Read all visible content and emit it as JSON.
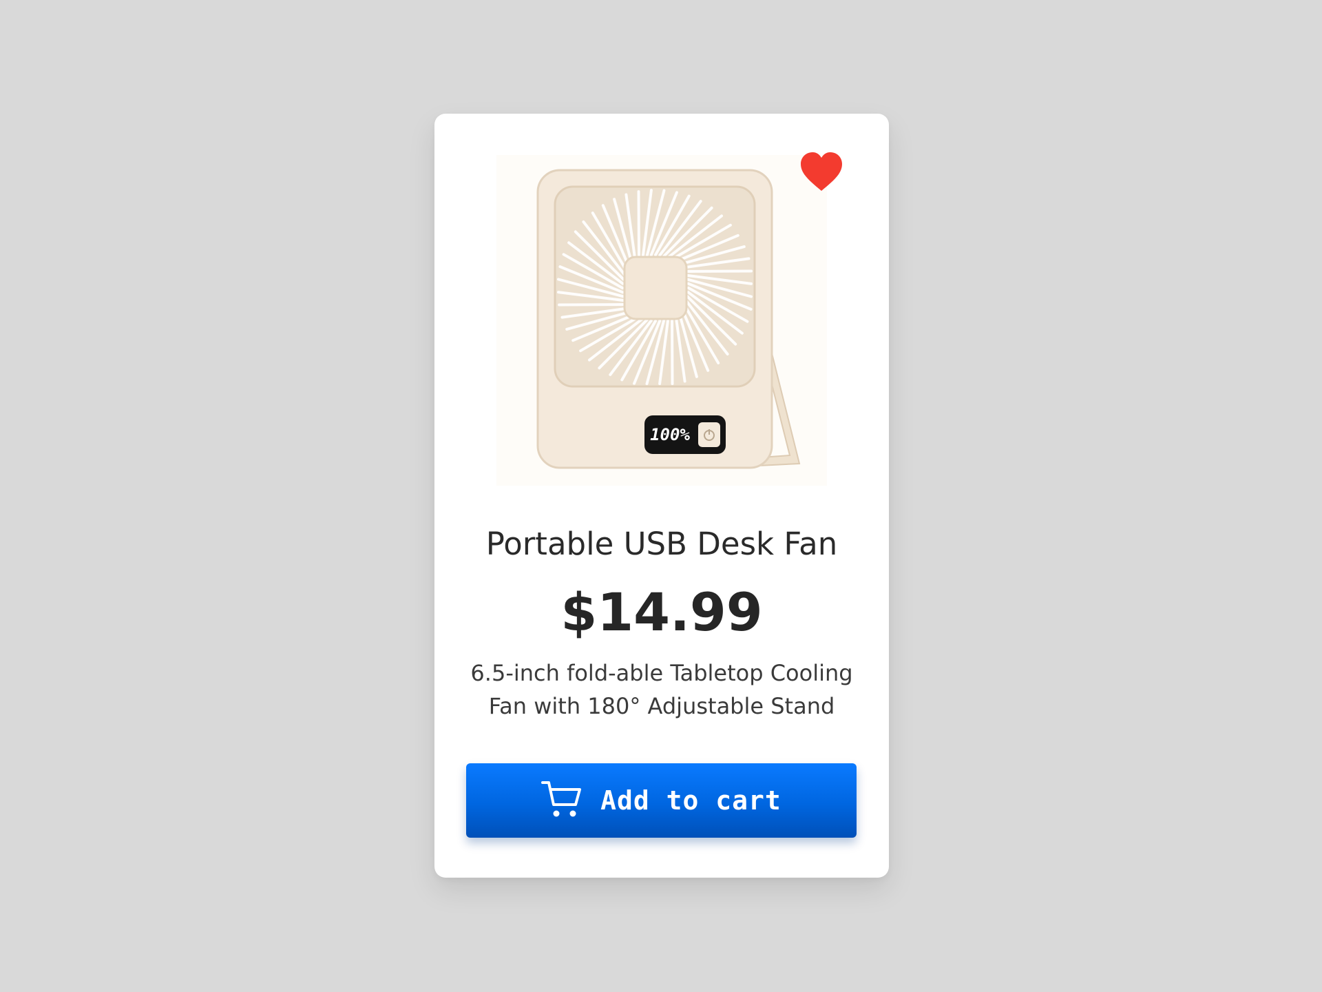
{
  "product": {
    "title": "Portable USB Desk Fan",
    "price": "$14.99",
    "description": "6.5-inch fold-able Tabletop Cooling Fan with 180° Adjustable Stand",
    "image_display_text": "100%",
    "favorited": true
  },
  "actions": {
    "add_to_cart_label": "Add to cart"
  },
  "icons": {
    "favorite": "heart-icon",
    "cart": "shopping-cart-icon",
    "power": "power-icon"
  },
  "colors": {
    "page_background": "#d9d9d9",
    "card_background": "#ffffff",
    "heart": "#f33b2f",
    "button": "#0066e0",
    "button_text": "#ffffff"
  }
}
